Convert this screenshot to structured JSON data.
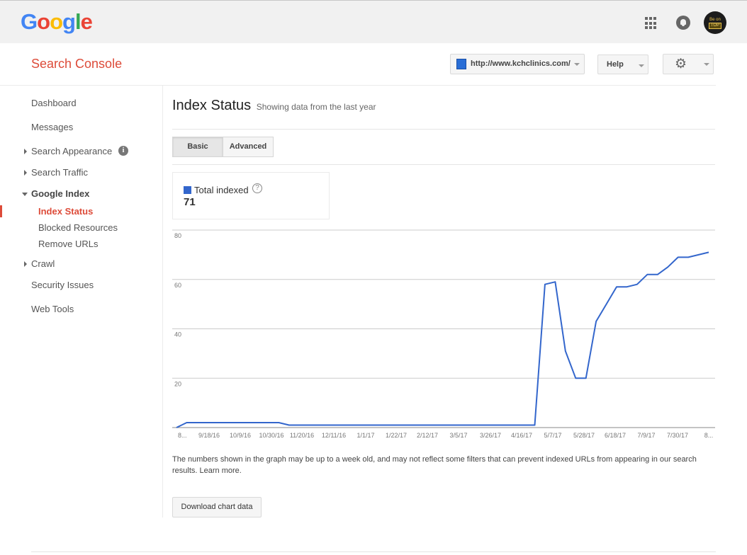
{
  "header": {
    "logo_letters": [
      {
        "ch": "G",
        "color": "#4285f4"
      },
      {
        "ch": "o",
        "color": "#ea4335"
      },
      {
        "ch": "o",
        "color": "#fbbc05"
      },
      {
        "ch": "g",
        "color": "#4285f4"
      },
      {
        "ch": "l",
        "color": "#34a853"
      },
      {
        "ch": "e",
        "color": "#ea4335"
      }
    ],
    "apps_icon": "apps-grid-icon",
    "notifications_icon": "bell-icon",
    "avatar_text_line1": "Be on",
    "avatar_text_line2": "TOP"
  },
  "product": {
    "title": "Search Console",
    "site_url": "http://www.kchclinics.com/",
    "help_label": "Help",
    "settings_icon": "gear-icon"
  },
  "sidebar": {
    "items": [
      {
        "label": "Dashboard"
      },
      {
        "label": "Messages"
      },
      {
        "label": "Search Appearance",
        "expandable": true,
        "info": true
      },
      {
        "label": "Search Traffic",
        "expandable": true
      },
      {
        "label": "Google Index",
        "expanded": true
      },
      {
        "label": "Index Status",
        "active": true
      },
      {
        "label": "Blocked Resources"
      },
      {
        "label": "Remove URLs"
      },
      {
        "label": "Crawl",
        "expandable": true
      },
      {
        "label": "Security Issues"
      },
      {
        "label": "Web Tools"
      }
    ]
  },
  "main": {
    "title": "Index Status",
    "subtitle": "Showing data from the last year",
    "tabs": [
      {
        "label": "Basic",
        "selected": true
      },
      {
        "label": "Advanced",
        "selected": false
      }
    ],
    "legend": {
      "label": "Total indexed",
      "value": "71",
      "color": "#3366cc"
    },
    "note": "The numbers shown in the graph may be up to a week old, and may not reflect some filters that can prevent indexed URLs from appearing in our search results.",
    "learn_more": "Learn more.",
    "download_label": "Download chart data"
  },
  "chart_data": {
    "type": "line",
    "title": "",
    "xlabel": "",
    "ylabel": "",
    "ylim": [
      0,
      80
    ],
    "yticks": [
      20,
      40,
      60,
      80
    ],
    "xtick_labels": [
      "8...",
      "9/18/16",
      "10/9/16",
      "10/30/16",
      "11/20/16",
      "12/11/16",
      "1/1/17",
      "1/22/17",
      "2/12/17",
      "3/5/17",
      "3/26/17",
      "4/16/17",
      "5/7/17",
      "5/28/17",
      "6/18/17",
      "7/9/17",
      "7/30/17",
      "8..."
    ],
    "grid": true,
    "series": [
      {
        "name": "Total indexed",
        "color": "#3366cc",
        "values": [
          0,
          2,
          2,
          2,
          2,
          2,
          2,
          2,
          2,
          2,
          2,
          1,
          1,
          1,
          1,
          1,
          1,
          1,
          1,
          1,
          1,
          1,
          1,
          1,
          1,
          1,
          1,
          1,
          1,
          1,
          1,
          1,
          1,
          1,
          1,
          1,
          58,
          59,
          31,
          20,
          20,
          43,
          50,
          57,
          57,
          58,
          62,
          62,
          65,
          69,
          69,
          70,
          71
        ]
      }
    ]
  }
}
